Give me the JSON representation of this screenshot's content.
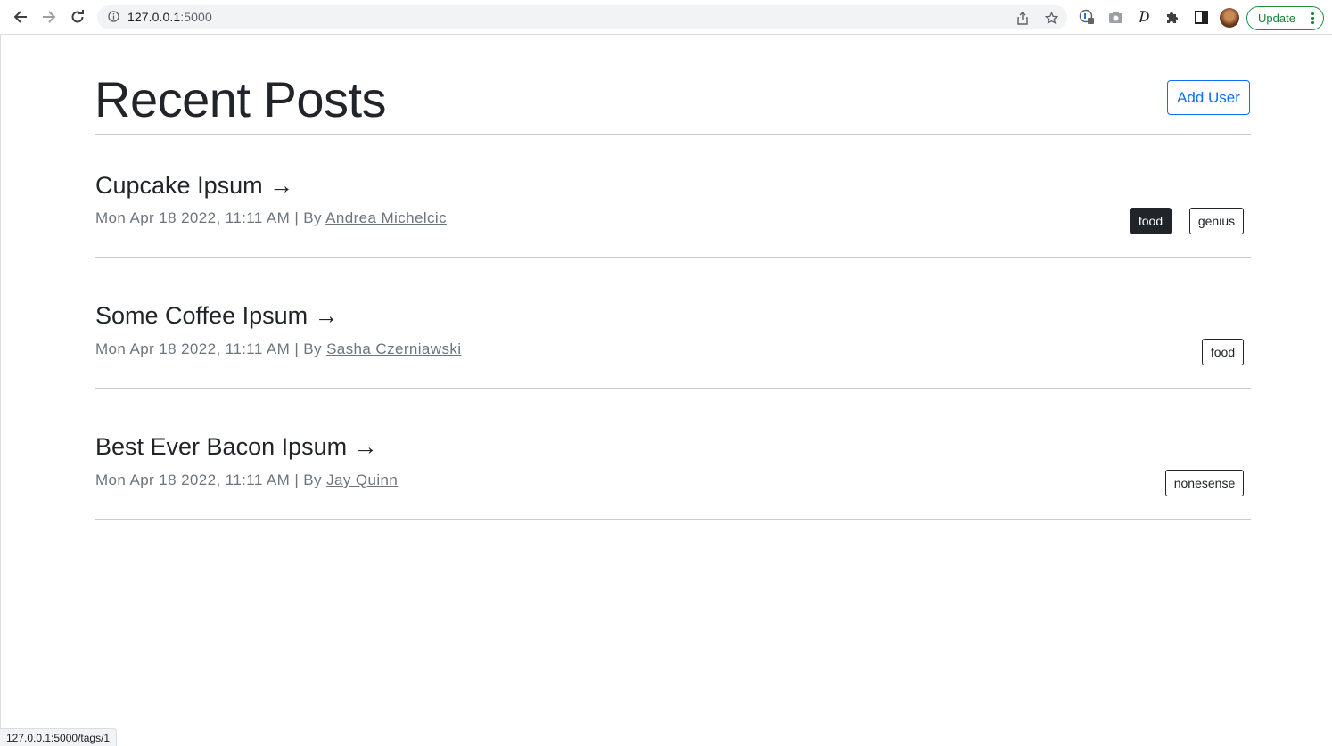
{
  "browser": {
    "url_host": "127.0.0.1",
    "url_port": ":5000",
    "update_label": "Update"
  },
  "page": {
    "title": "Recent Posts",
    "add_user_label": "Add User"
  },
  "posts": [
    {
      "title": "Cupcake Ipsum →",
      "meta_prefix": "Mon Apr 18 2022, 11:11 AM | By ",
      "author": "Andrea Michelcic",
      "tags": [
        "food",
        "genius"
      ]
    },
    {
      "title": "Some Coffee Ipsum →",
      "meta_prefix": "Mon Apr 18 2022, 11:11 AM | By ",
      "author": "Sasha Czerniawski",
      "tags": [
        "food"
      ]
    },
    {
      "title": "Best Ever Bacon Ipsum →",
      "meta_prefix": "Mon Apr 18 2022, 11:11 AM | By ",
      "author": "Jay Quinn",
      "tags": [
        "nonesense"
      ]
    }
  ],
  "status_bar": "127.0.0.1:5000/tags/1",
  "icons": [
    "back-icon",
    "forward-icon",
    "reload-icon",
    "info-icon",
    "share-icon",
    "star-icon",
    "extension-key-icon",
    "camera-icon",
    "dark-reader-icon",
    "puzzle-icon",
    "side-panel-icon",
    "more-icon"
  ],
  "colors": {
    "primary": "#0d6efd",
    "muted": "#6c757d",
    "dark": "#212529",
    "update_green": "#188038"
  }
}
